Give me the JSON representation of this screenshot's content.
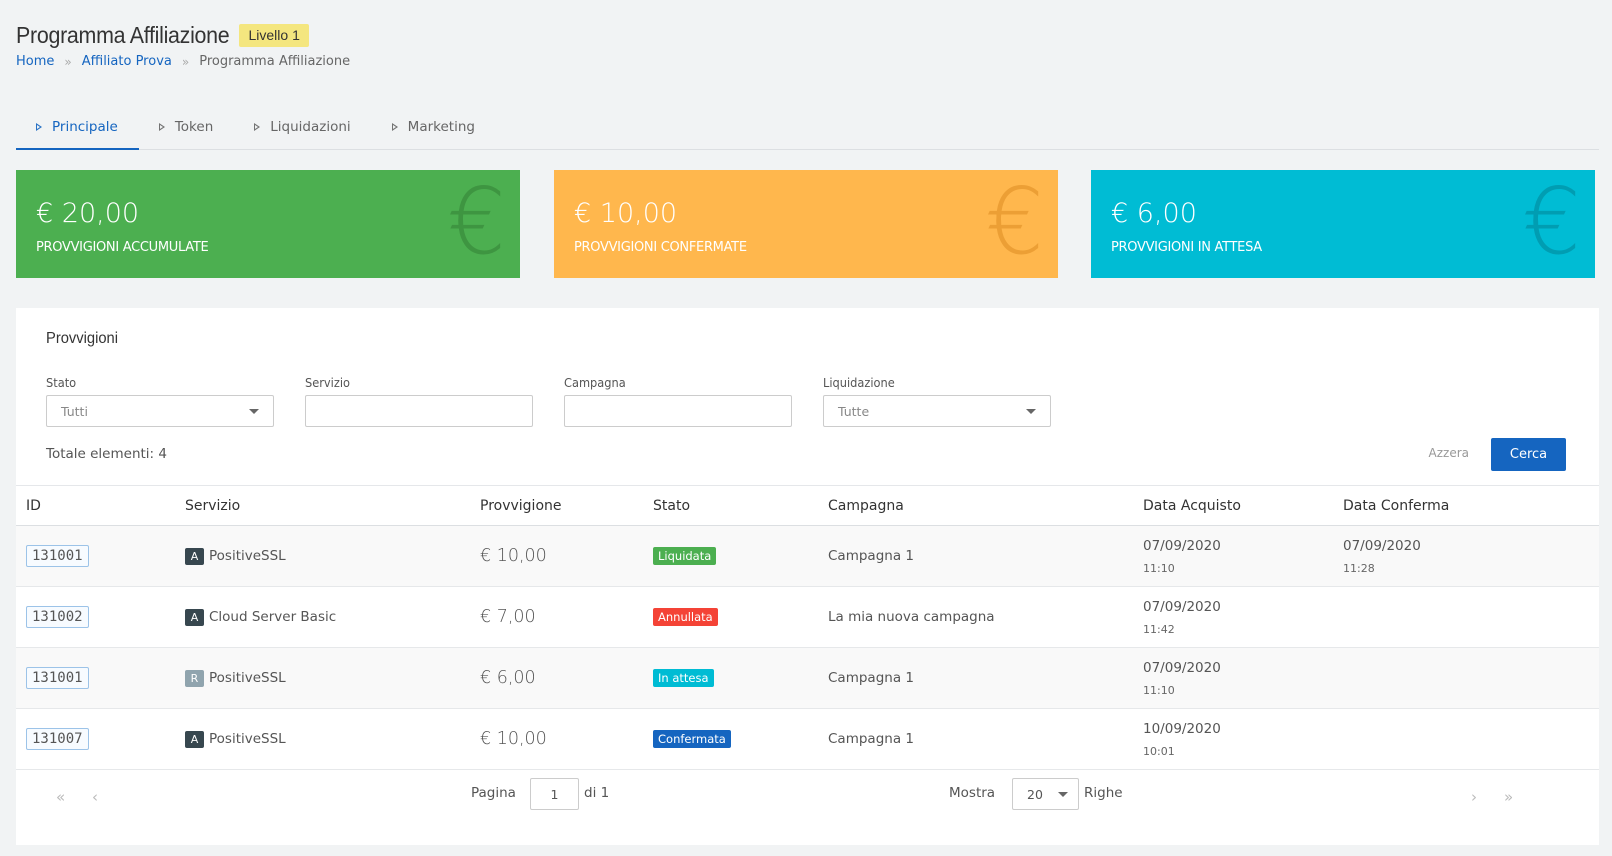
{
  "header": {
    "title": "Programma Affiliazione",
    "level_badge": "Livello 1",
    "breadcrumb": [
      {
        "label": "Home"
      },
      {
        "label": "Affiliato Prova"
      },
      {
        "label": "Programma Affiliazione"
      }
    ],
    "separator": "»"
  },
  "tabs": [
    {
      "label": "Principale",
      "active": true
    },
    {
      "label": "Token",
      "active": false
    },
    {
      "label": "Liquidazioni",
      "active": false
    },
    {
      "label": "Marketing",
      "active": false
    }
  ],
  "stats": [
    {
      "value": "€ 20,00",
      "label": "PROVVIGIONI ACCUMULATE",
      "color": "#4caf50",
      "icon_color": "#3b8f3e",
      "icon": "euro-icon",
      "glyph": "€"
    },
    {
      "value": "€ 10,00",
      "label": "PROVVIGIONI CONFERMATE",
      "color": "#ffb74d",
      "icon_color": "#e89a30",
      "icon": "euro-icon",
      "glyph": "€"
    },
    {
      "value": "€ 6,00",
      "label": "PROVVIGIONI IN ATTESA",
      "color": "#00bcd4",
      "icon_color": "#0096aa",
      "icon": "euro-icon",
      "glyph": "€"
    }
  ],
  "panel": {
    "title": "Provvigioni",
    "filters": {
      "stato": {
        "label": "Stato",
        "value": "Tutti"
      },
      "servizio": {
        "label": "Servizio",
        "value": ""
      },
      "campagna": {
        "label": "Campagna",
        "value": ""
      },
      "liquidazione": {
        "label": "Liquidazione",
        "value": "Tutte"
      }
    },
    "total": "Totale elementi: 4",
    "reset_label": "Azzera",
    "search_label": "Cerca"
  },
  "table": {
    "columns": {
      "id": "ID",
      "servizio": "Servizio",
      "provvigione": "Provvigione",
      "stato": "Stato",
      "campagna": "Campagna",
      "data_acquisto": "Data Acquisto",
      "data_conferma": "Data Conferma"
    },
    "rows": [
      {
        "id": "131001",
        "svc_badge": "A",
        "svc_badge_color": "#37474f",
        "servizio": "PositiveSSL",
        "provvigione": "€ 10,00",
        "stato": "Liquidata",
        "stato_color": "#4caf50",
        "campagna": "Campagna 1",
        "acq_date": "07/09/2020",
        "acq_time": "11:10",
        "conf_date": "07/09/2020",
        "conf_time": "11:28"
      },
      {
        "id": "131002",
        "svc_badge": "A",
        "svc_badge_color": "#37474f",
        "servizio": "Cloud Server Basic",
        "provvigione": "€ 7,00",
        "stato": "Annullata",
        "stato_color": "#f44336",
        "campagna": "La mia nuova campagna",
        "acq_date": "07/09/2020",
        "acq_time": "11:42",
        "conf_date": "",
        "conf_time": ""
      },
      {
        "id": "131001",
        "svc_badge": "R",
        "svc_badge_color": "#90a4ae",
        "servizio": "PositiveSSL",
        "provvigione": "€ 6,00",
        "stato": "In attesa",
        "stato_color": "#00bcd4",
        "campagna": "Campagna 1",
        "acq_date": "07/09/2020",
        "acq_time": "11:10",
        "conf_date": "",
        "conf_time": ""
      },
      {
        "id": "131007",
        "svc_badge": "A",
        "svc_badge_color": "#37474f",
        "servizio": "PositiveSSL",
        "provvigione": "€ 10,00",
        "stato": "Confermata",
        "stato_color": "#1565c0",
        "campagna": "Campagna 1",
        "acq_date": "10/09/2020",
        "acq_time": "10:01",
        "conf_date": "",
        "conf_time": ""
      }
    ]
  },
  "pagination": {
    "page_label": "Pagina",
    "page_value": "1",
    "of_label": "di 1",
    "show_label": "Mostra",
    "rows_value": "20",
    "rows_label": "Righe",
    "first": "«",
    "prev": "‹",
    "next": "›",
    "last": "»"
  }
}
